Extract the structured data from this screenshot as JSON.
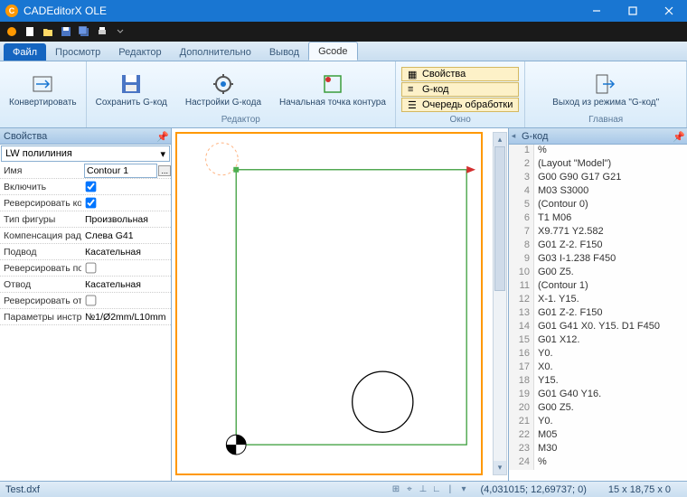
{
  "window": {
    "title": "CADEditorX OLE"
  },
  "menu": {
    "file": "Файл",
    "items": [
      "Просмотр",
      "Редактор",
      "Дополнительно",
      "Вывод",
      "Gcode"
    ],
    "active": "Gcode"
  },
  "ribbon": {
    "groups": [
      {
        "name": "",
        "items": [
          {
            "label": "Конвертировать"
          }
        ]
      },
      {
        "name": "Редактор",
        "items": [
          {
            "label": "Сохранить G-код"
          },
          {
            "label": "Настройки G-кода"
          },
          {
            "label": "Начальная точка контура"
          }
        ]
      },
      {
        "name": "Окно",
        "stack": [
          {
            "label": "Свойства"
          },
          {
            "label": "G-код"
          },
          {
            "label": "Очередь обработки"
          }
        ]
      },
      {
        "name": "Главная",
        "items": [
          {
            "label": "Выход из режима \"G-код\""
          }
        ]
      }
    ]
  },
  "props": {
    "title": "Свойства",
    "selector": "LW полилиния",
    "rows": [
      {
        "name": "Имя",
        "type": "text",
        "value": "Contour 1",
        "dots": true
      },
      {
        "name": "Включить",
        "type": "check",
        "value": true
      },
      {
        "name": "Реверсировать ко",
        "type": "check",
        "value": true
      },
      {
        "name": "Тип фигуры",
        "type": "label",
        "value": "Произвольная"
      },
      {
        "name": "Компенсация ради",
        "type": "label",
        "value": "Слева G41"
      },
      {
        "name": "Подвод",
        "type": "label",
        "value": "Касательная"
      },
      {
        "name": "Реверсировать по",
        "type": "check",
        "value": false
      },
      {
        "name": "Отвод",
        "type": "label",
        "value": "Касательная"
      },
      {
        "name": "Реверсировать от",
        "type": "check",
        "value": false
      },
      {
        "name": "Параметры инстр.",
        "type": "label",
        "value": "№1/Ø2mm/L10mm"
      }
    ]
  },
  "gcode": {
    "title": "G-код",
    "lines": [
      "%",
      "(Layout \"Model\")",
      "G00 G90 G17 G21",
      "M03 S3000",
      "(Contour 0)",
      "T1 M06",
      "X9.771 Y2.582",
      "G01 Z-2. F150",
      "G03 I-1.238 F450",
      "G00 Z5.",
      "(Contour 1)",
      "X-1. Y15.",
      "G01 Z-2. F150",
      "G01 G41 X0. Y15. D1 F450",
      "G01 X12.",
      "Y0.",
      "X0.",
      "Y15.",
      "G01 G40 Y16.",
      "G00 Z5.",
      "Y0.",
      "M05",
      "M30",
      "%"
    ]
  },
  "status": {
    "file": "Test.dxf",
    "coords": "(4,031015; 12,69737; 0)",
    "dims": "15 x 18,75 x 0"
  }
}
